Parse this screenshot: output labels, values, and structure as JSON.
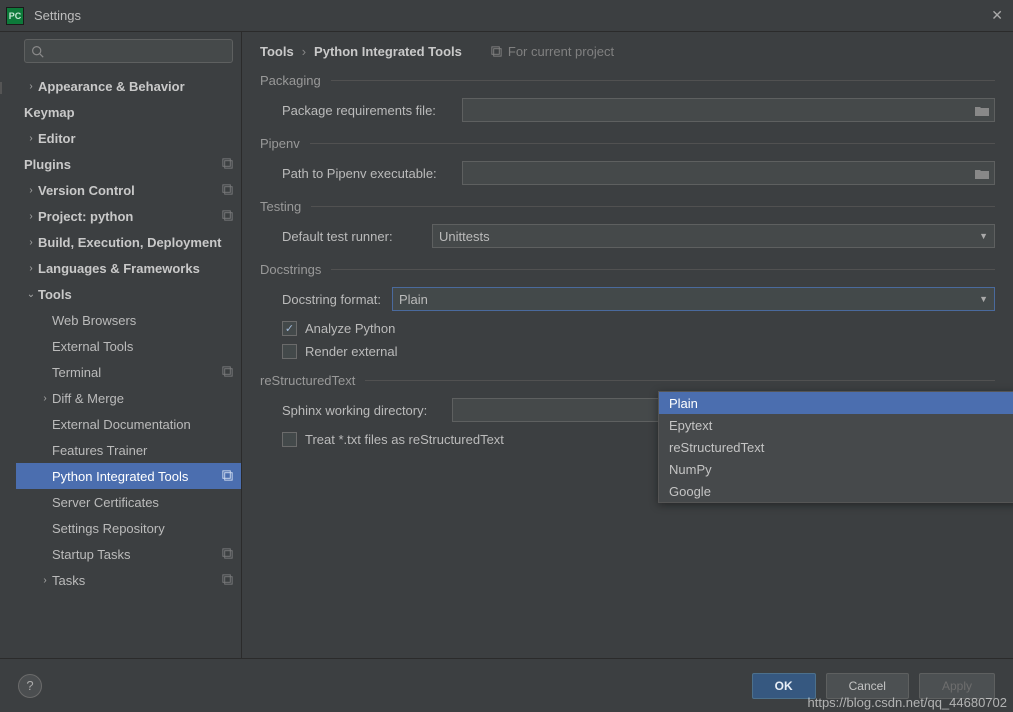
{
  "window": {
    "title": "Settings"
  },
  "search": {
    "placeholder": ""
  },
  "sidebar": {
    "items": [
      {
        "label": "Appearance & Behavior",
        "bold": true,
        "chev": "›",
        "depth": 0
      },
      {
        "label": "Keymap",
        "bold": true,
        "depth": 0,
        "nochev": true
      },
      {
        "label": "Editor",
        "bold": true,
        "chev": "›",
        "depth": 0
      },
      {
        "label": "Plugins",
        "bold": true,
        "depth": 0,
        "nochev": true,
        "badge": true
      },
      {
        "label": "Version Control",
        "bold": true,
        "chev": "›",
        "depth": 0,
        "badge": true
      },
      {
        "label": "Project: python",
        "bold": true,
        "chev": "›",
        "depth": 0,
        "badge": true
      },
      {
        "label": "Build, Execution, Deployment",
        "bold": true,
        "chev": "›",
        "depth": 0
      },
      {
        "label": "Languages & Frameworks",
        "bold": true,
        "chev": "›",
        "depth": 0
      },
      {
        "label": "Tools",
        "bold": true,
        "chev": "⌄",
        "depth": 0
      },
      {
        "label": "Web Browsers",
        "depth": 1,
        "nochev": true
      },
      {
        "label": "External Tools",
        "depth": 1,
        "nochev": true
      },
      {
        "label": "Terminal",
        "depth": 1,
        "nochev": true,
        "badge": true
      },
      {
        "label": "Diff & Merge",
        "depth": 1,
        "chev": "›"
      },
      {
        "label": "External Documentation",
        "depth": 1,
        "nochev": true
      },
      {
        "label": "Features Trainer",
        "depth": 1,
        "nochev": true
      },
      {
        "label": "Python Integrated Tools",
        "depth": 1,
        "nochev": true,
        "badge": true,
        "selected": true
      },
      {
        "label": "Server Certificates",
        "depth": 1,
        "nochev": true
      },
      {
        "label": "Settings Repository",
        "depth": 1,
        "nochev": true
      },
      {
        "label": "Startup Tasks",
        "depth": 1,
        "nochev": true,
        "badge": true
      },
      {
        "label": "Tasks",
        "depth": 1,
        "chev": "›",
        "badge": true
      }
    ]
  },
  "breadcrumb": {
    "root": "Tools",
    "leaf": "Python Integrated Tools",
    "for_current": "For current project"
  },
  "sections": {
    "packaging": {
      "title": "Packaging",
      "req_label": "Package requirements file:",
      "req_value": ""
    },
    "pipenv": {
      "title": "Pipenv",
      "path_label": "Path to Pipenv executable:",
      "path_value": ""
    },
    "testing": {
      "title": "Testing",
      "runner_label": "Default test runner:",
      "runner_value": "Unittests"
    },
    "docstrings": {
      "title": "Docstrings",
      "format_label": "Docstring format:",
      "format_value": "Plain",
      "analyze_label": "Analyze Python",
      "render_label": "Render external",
      "options": [
        "Plain",
        "Epytext",
        "reStructuredText",
        "NumPy",
        "Google"
      ]
    },
    "rst": {
      "title": "reStructuredText",
      "sphinx_label": "Sphinx working directory:",
      "sphinx_value": "",
      "treat_label": "Treat *.txt files as reStructuredText"
    }
  },
  "buttons": {
    "ok": "OK",
    "cancel": "Cancel",
    "apply": "Apply",
    "help": "?"
  },
  "watermark": "https://blog.csdn.net/qq_44680702"
}
